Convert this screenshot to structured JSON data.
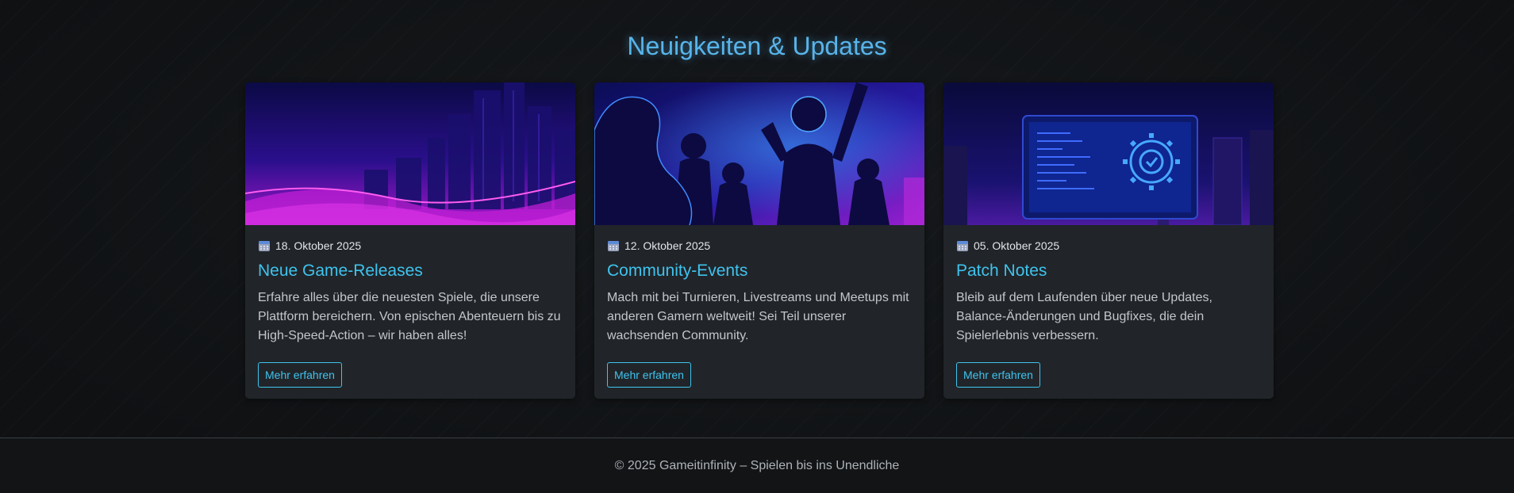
{
  "section": {
    "title": "Neuigkeiten & Updates"
  },
  "cards": [
    {
      "image": "city-skyline-illustration",
      "date": "18. Oktober 2025",
      "title": "Neue Game-Releases",
      "text": "Erfahre alles über die neuesten Spiele, die unsere Plattform bereichern. Von epischen Abenteuern bis zu High-Speed-Action – wir haben alles!",
      "button": "Mehr erfahren"
    },
    {
      "image": "gamers-crowd-illustration",
      "date": "12. Oktober 2025",
      "title": "Community-Events",
      "text": "Mach mit bei Turnieren, Livestreams und Meetups mit anderen Gamern weltweit! Sei Teil unserer wachsenden Community.",
      "button": "Mehr erfahren"
    },
    {
      "image": "monitor-gear-illustration",
      "date": "05. Oktober 2025",
      "title": "Patch Notes",
      "text": "Bleib auf dem Laufenden über neue Updates, Balance-Änderungen und Bugfixes, die dein Spielerlebnis verbessern.",
      "button": "Mehr erfahren"
    }
  ],
  "icons": {
    "date": "calendar-icon"
  },
  "colors": {
    "accent": "#3fc3ee",
    "title": "#58b4ea",
    "card": "#212529",
    "background": "#111315"
  },
  "footer": {
    "text": "© 2025 Gameitinfinity – Spielen bis ins Unendliche"
  }
}
